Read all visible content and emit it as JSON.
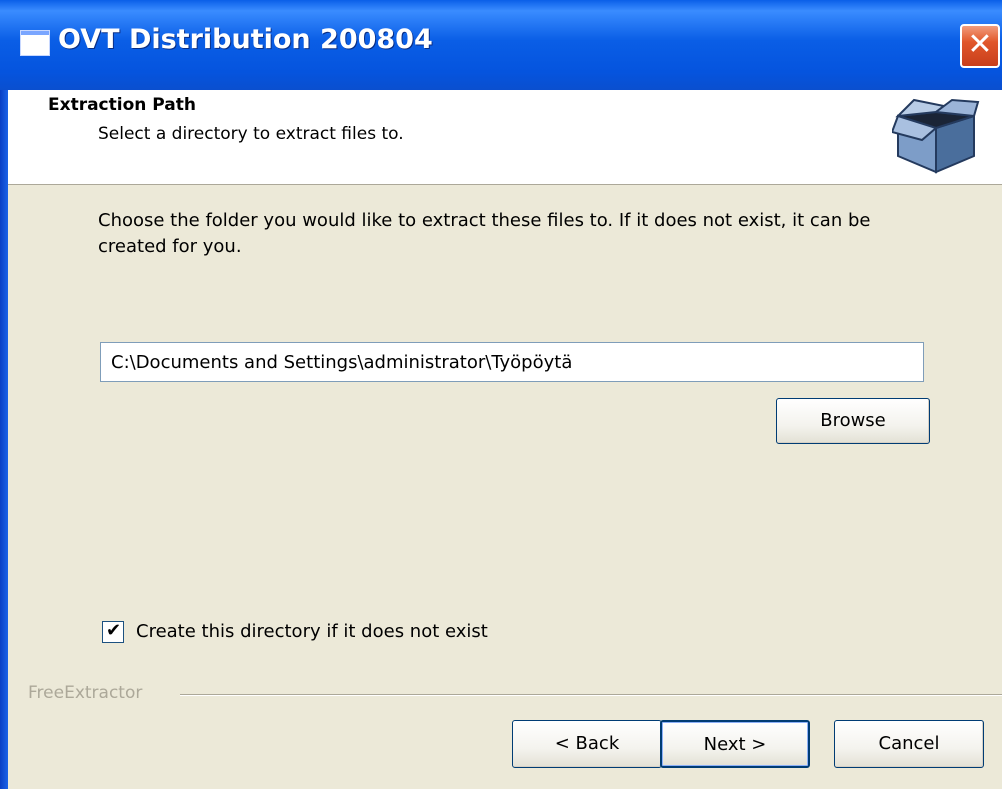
{
  "window": {
    "title": "OVT Distribution 200804",
    "close_symbol": "✕"
  },
  "header": {
    "title": "Extraction Path",
    "subtitle": "Select a directory to extract files to.",
    "icon": "open-box-icon"
  },
  "body": {
    "description": "Choose the folder you would like to extract these files to. If it does not exist, it can be created for you.",
    "path_value": "C:\\Documents and Settings\\administrator\\Työpöytä",
    "browse_label": "Browse",
    "checkbox_label": "Create this directory if it does not exist",
    "checkbox_checked": true,
    "checkbox_mark": "✔"
  },
  "footer": {
    "brand": "FreeExtractor",
    "back_label": "< Back",
    "next_label": "Next >",
    "cancel_label": "Cancel"
  },
  "colors": {
    "titlebar": "#0a5ee6",
    "face": "#ece9d8",
    "close": "#e1572a"
  }
}
